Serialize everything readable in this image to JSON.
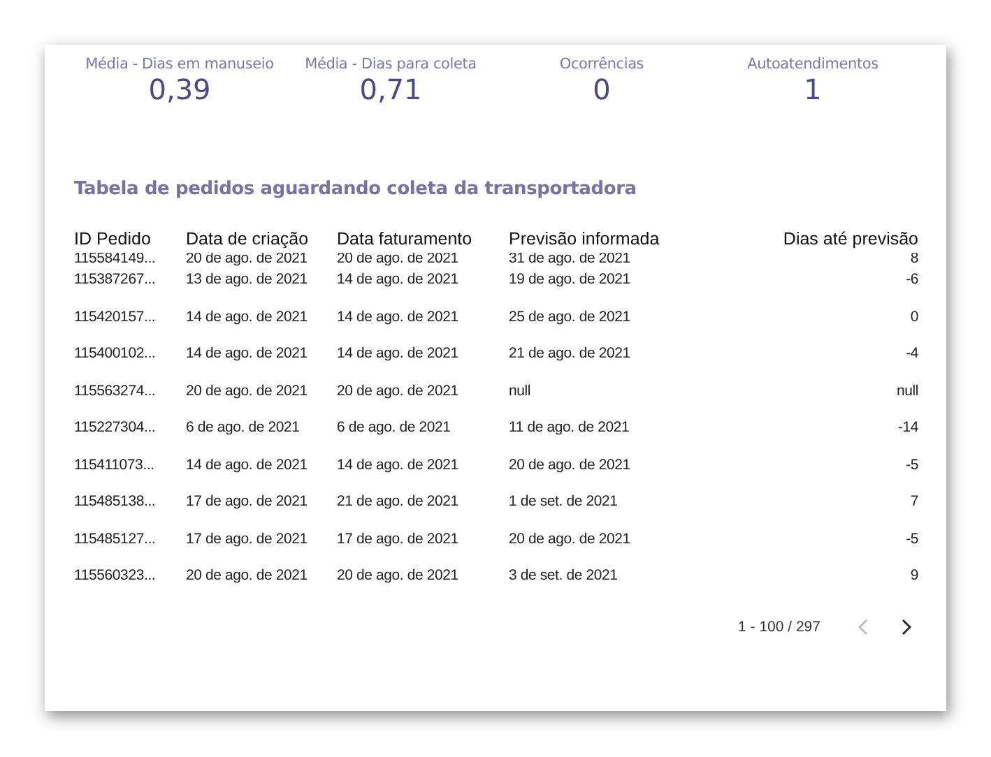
{
  "metrics": [
    {
      "label": "Média - Dias em manuseio",
      "value": "0,39"
    },
    {
      "label": "Média - Dias para coleta",
      "value": "0,71"
    },
    {
      "label": "Ocorrências",
      "value": "0"
    },
    {
      "label": "Autoatendimentos",
      "value": "1"
    }
  ],
  "table": {
    "title": "Tabela de pedidos aguardando coleta da transportadora",
    "columns": [
      "ID Pedido",
      "Data de criação",
      "Data faturamento",
      "Previsão informada",
      "Dias até previsão"
    ],
    "rows": [
      [
        "115584149...",
        "20 de ago. de 2021",
        "20 de ago. de 2021",
        "31 de ago. de 2021",
        "8"
      ],
      [
        "115387267...",
        "13 de ago. de 2021",
        "14 de ago. de 2021",
        "19 de ago. de 2021",
        "-6"
      ],
      [
        "115420157...",
        "14 de ago. de 2021",
        "14 de ago. de 2021",
        "25 de ago. de 2021",
        "0"
      ],
      [
        "115400102...",
        "14 de ago. de 2021",
        "14 de ago. de 2021",
        "21 de ago. de 2021",
        "-4"
      ],
      [
        "115563274...",
        "20 de ago. de 2021",
        "20 de ago. de 2021",
        "null",
        "null"
      ],
      [
        "115227304...",
        "6 de ago. de 2021",
        "6 de ago. de 2021",
        "11 de ago. de 2021",
        "-14"
      ],
      [
        "115411073...",
        "14 de ago. de 2021",
        "14 de ago. de 2021",
        "20 de ago. de 2021",
        "-5"
      ],
      [
        "115485138...",
        "17 de ago. de 2021",
        "21 de ago. de 2021",
        "1 de set. de 2021",
        "7"
      ],
      [
        "115485127...",
        "17 de ago. de 2021",
        "17 de ago. de 2021",
        "20 de ago. de 2021",
        "-5"
      ],
      [
        "115560323...",
        "20 de ago. de 2021",
        "20 de ago. de 2021",
        "3 de set. de 2021",
        "9"
      ]
    ],
    "pagination": {
      "range": "1 - 100 / 297",
      "prev_disabled": true,
      "next_disabled": false
    }
  }
}
